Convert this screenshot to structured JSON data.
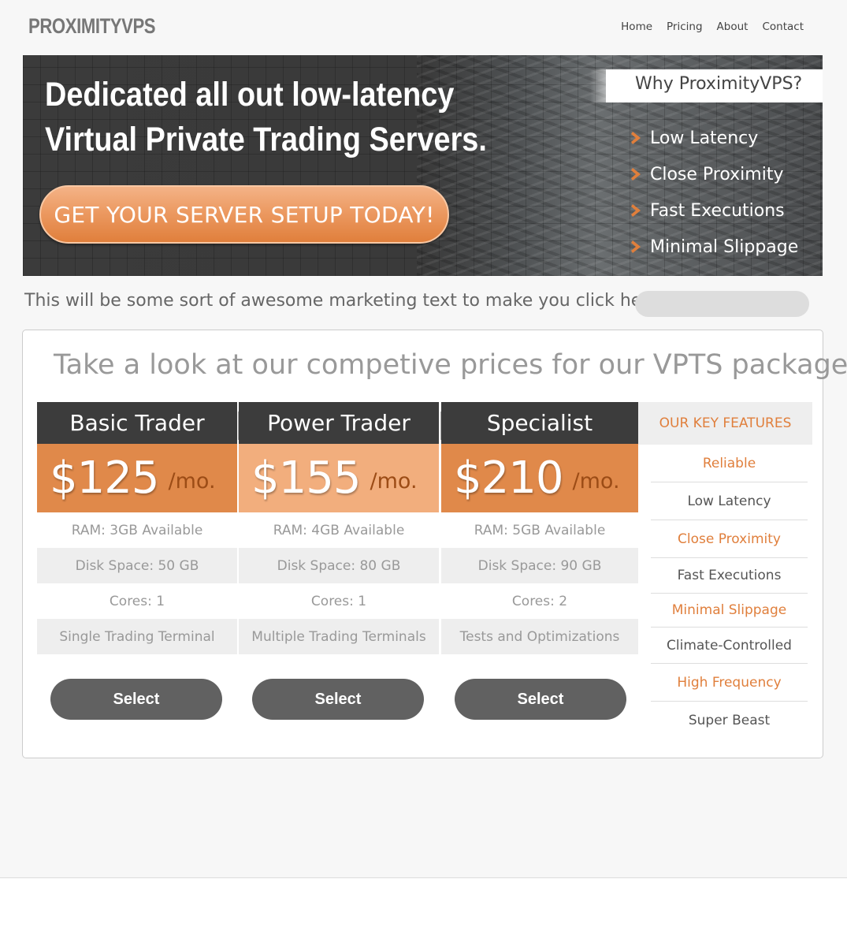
{
  "header": {
    "logo": "PROXIMITYVPS",
    "nav": [
      "Home",
      "Pricing",
      "About",
      "Contact"
    ]
  },
  "hero": {
    "title_line1": "Dedicated all out low-latency",
    "title_line2": "Virtual Private Trading Servers.",
    "cta": "GET YOUR SERVER SETUP TODAY!",
    "why_title": "Why ProximityVPS?",
    "why_items": [
      "Low Latency",
      "Close Proximity",
      "Fast Executions",
      "Minimal Slippage"
    ]
  },
  "marketing": {
    "text": "This will be some sort of awesome marketing text to make you click here"
  },
  "pricing": {
    "title": "Take a look at our competive prices for our VPTS packages",
    "plans": [
      {
        "name": "Basic Trader",
        "price": "$125",
        "period": "/mo.",
        "ram": "RAM: 3GB Available",
        "disk": "Disk Space: 50 GB",
        "cores": "Cores: 1",
        "extra": "Single Trading Terminal",
        "button": "Select"
      },
      {
        "name": "Power Trader",
        "price": "$155",
        "period": "/mo.",
        "ram": "RAM: 4GB Available",
        "disk": "Disk Space: 80 GB",
        "cores": "Cores: 1",
        "extra": "Multiple Trading Terminals",
        "button": "Select"
      },
      {
        "name": "Specialist",
        "price": "$210",
        "period": "/mo.",
        "ram": "RAM: 5GB Available",
        "disk": "Disk Space: 90 GB",
        "cores": "Cores: 2",
        "extra": "Tests and Optimizations",
        "button": "Select"
      }
    ],
    "features_title": "OUR KEY FEATURES",
    "features": [
      "Reliable",
      "Low Latency",
      "Close Proximity",
      "Fast Executions",
      "Minimal Slippage",
      "Climate-Controlled",
      "High Frequency",
      "Super Beast"
    ]
  },
  "colors": {
    "accent": "#e0894a",
    "accent_light": "#f2ae7d",
    "dark": "#3c3c3c",
    "button": "#616161"
  }
}
